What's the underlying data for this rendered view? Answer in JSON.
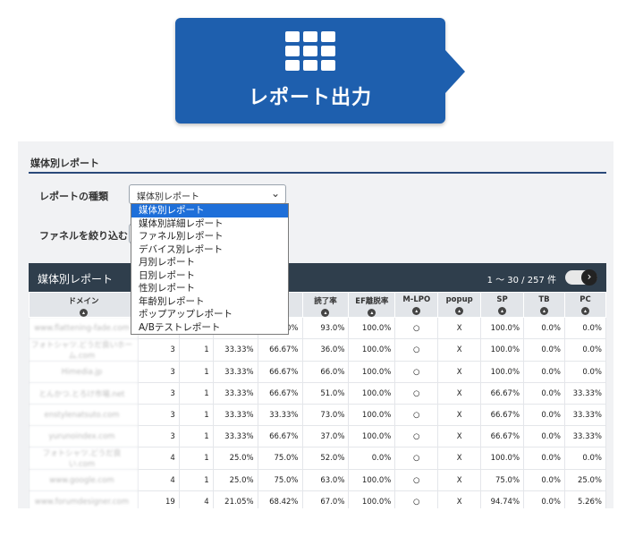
{
  "export_button": {
    "label": "レポート出力",
    "icon": "table-grid-icon",
    "color": "#1e5fae"
  },
  "panel": {
    "title": "媒体別レポート",
    "report_type_label": "レポートの種類",
    "report_type_value": "媒体別レポート",
    "funnel_label": "ファネルを絞り込む"
  },
  "dropdown_options": [
    "媒体別レポート",
    "媒体別詳細レポート",
    "ファネル別レポート",
    "デバイス別レポート",
    "月別レポート",
    "日別レポート",
    "性別レポート",
    "年齢別レポート",
    "ポップアップレポート",
    "A/Bテストレポート"
  ],
  "table": {
    "title": "媒体別レポート",
    "pager": "1 〜 30 / 257 件",
    "columns": [
      "ドメイン",
      "",
      "",
      "",
      "率",
      "読了率",
      "EF離脱率",
      "M-LPO",
      "popup",
      "SP",
      "TB",
      "PC"
    ],
    "rows": [
      [
        "www.flattening-fade.com",
        "",
        "",
        "",
        "0%",
        "93.0%",
        "100.0%",
        "○",
        "X",
        "100.0%",
        "0.0%",
        "0.0%"
      ],
      [
        "フォトシャツ.どうだ良いホーム.com",
        "3",
        "1",
        "33.33%",
        "66.67%",
        "36.0%",
        "100.0%",
        "○",
        "X",
        "100.0%",
        "0.0%",
        "0.0%"
      ],
      [
        "Himedia.jp",
        "3",
        "1",
        "33.33%",
        "66.67%",
        "66.0%",
        "100.0%",
        "○",
        "X",
        "100.0%",
        "0.0%",
        "0.0%"
      ],
      [
        "とんかつ.とろけ市場.net",
        "3",
        "1",
        "33.33%",
        "66.67%",
        "51.0%",
        "100.0%",
        "○",
        "X",
        "66.67%",
        "0.0%",
        "33.33%"
      ],
      [
        "enstylenatsuto.com",
        "3",
        "1",
        "33.33%",
        "33.33%",
        "73.0%",
        "100.0%",
        "○",
        "X",
        "66.67%",
        "0.0%",
        "33.33%"
      ],
      [
        "yurunoindex.com",
        "3",
        "1",
        "33.33%",
        "66.67%",
        "37.0%",
        "100.0%",
        "○",
        "X",
        "66.67%",
        "0.0%",
        "33.33%"
      ],
      [
        "フォトシャツ.どうだ良い.com",
        "4",
        "1",
        "25.0%",
        "75.0%",
        "52.0%",
        "0.0%",
        "○",
        "X",
        "100.0%",
        "0.0%",
        "0.0%"
      ],
      [
        "www.google.com",
        "4",
        "1",
        "25.0%",
        "75.0%",
        "63.0%",
        "100.0%",
        "○",
        "X",
        "75.0%",
        "0.0%",
        "25.0%"
      ],
      [
        "www.forumdesigner.com",
        "19",
        "4",
        "21.05%",
        "68.42%",
        "67.0%",
        "100.0%",
        "○",
        "X",
        "94.74%",
        "0.0%",
        "5.26%"
      ]
    ]
  }
}
